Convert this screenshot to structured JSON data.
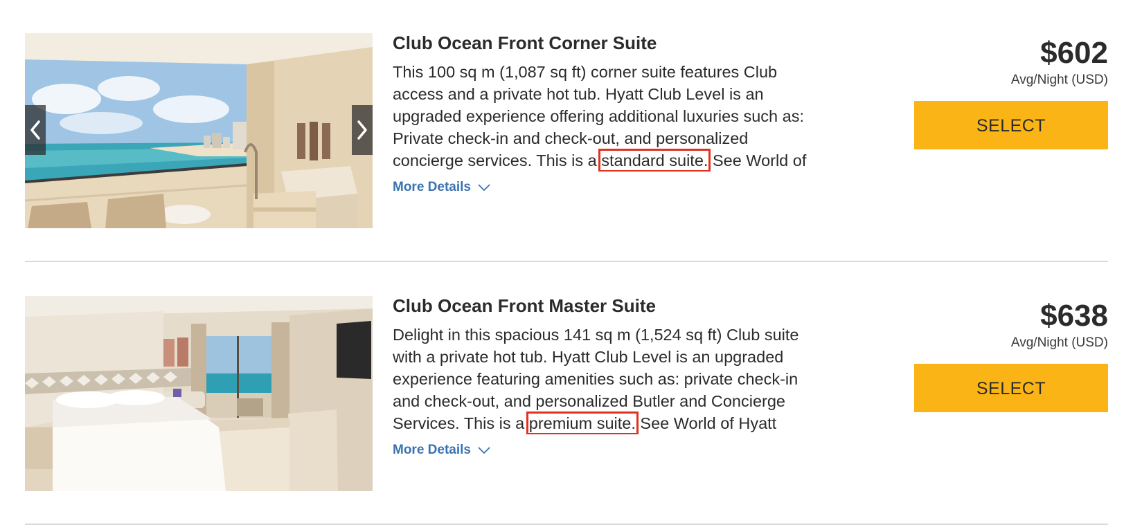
{
  "rooms": [
    {
      "title": "Club Ocean Front Corner Suite",
      "desc_before": "This 100 sq m (1,087 sq ft) corner suite features Club access and a private hot tub. Hyatt Club Level is an upgraded experience offering additional luxuries such as: Private check-in and check-out, and personalized concierge services. This is a ",
      "desc_highlight": "standard suite.",
      "desc_after": " See World of",
      "more_details": "More Details",
      "price": "$602",
      "price_note": "Avg/Night (USD)",
      "select_label": "SELECT",
      "has_carousel": true
    },
    {
      "title": "Club Ocean Front Master Suite",
      "desc_before": "Delight in this spacious 141 sq m (1,524 sq ft) Club suite with a private hot tub. Hyatt Club Level is an upgraded experience featuring amenities such as: private check-in and check-out, and personalized Butler and Concierge Services. This is a ",
      "desc_highlight": "premium suite.",
      "desc_after": " See World of Hyatt",
      "more_details": "More Details",
      "price": "$638",
      "price_note": "Avg/Night (USD)",
      "select_label": "SELECT",
      "has_carousel": false
    }
  ],
  "colors": {
    "select_button": "#fbb416",
    "link": "#2b6cb0",
    "highlight_box": "#e0301e",
    "divider": "#d9d9d9"
  },
  "icons": {
    "carousel_prev": "chevron-left-icon",
    "carousel_next": "chevron-right-icon",
    "more_details": "chevron-down-icon"
  }
}
